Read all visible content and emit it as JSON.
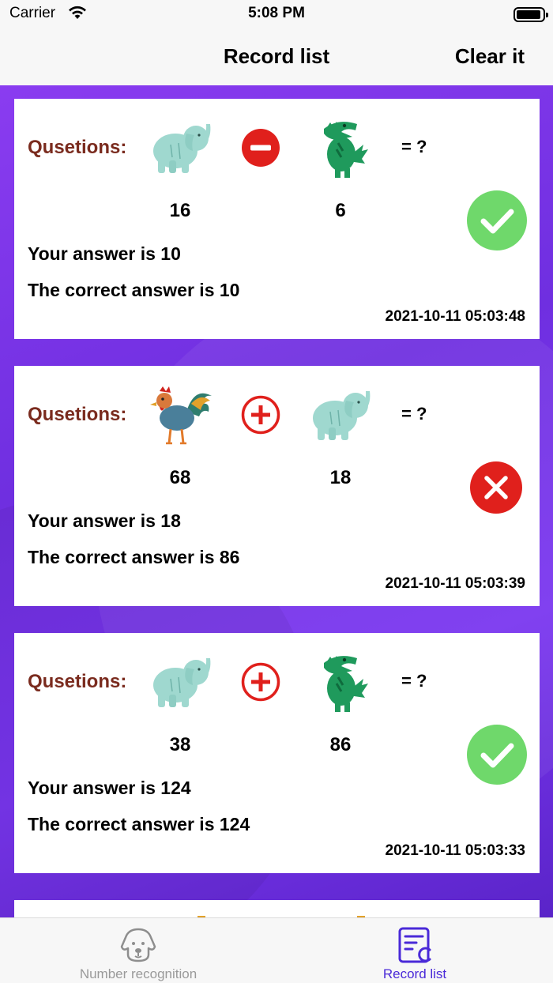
{
  "status_bar": {
    "carrier": "Carrier",
    "time": "5:08 PM"
  },
  "nav": {
    "title": "Record list",
    "clear_label": "Clear it"
  },
  "colors": {
    "accent": "#4a2ad8",
    "correct": "#6fd86b",
    "wrong": "#e0201c",
    "question_label": "#7a2b1e"
  },
  "records": [
    {
      "label": "Qusetions:",
      "left_animal": "elephant-icon",
      "operator": "minus-icon",
      "right_animal": "crocodile-icon",
      "equals": "= ?",
      "left_number": "16",
      "right_number": "6",
      "answer": "Your answer is 10",
      "correct": "The correct answer is 10",
      "time": "2021-10-11 05:03:48",
      "result": "correct"
    },
    {
      "label": "Qusetions:",
      "left_animal": "rooster-icon",
      "operator": "plus-icon",
      "right_animal": "elephant-icon",
      "equals": "= ?",
      "left_number": "68",
      "right_number": "18",
      "answer": "Your answer is 18",
      "correct": "The correct answer is 86",
      "time": "2021-10-11 05:03:39",
      "result": "wrong"
    },
    {
      "label": "Qusetions:",
      "left_animal": "elephant-icon",
      "operator": "plus-icon",
      "right_animal": "crocodile-icon",
      "equals": "= ?",
      "left_number": "38",
      "right_number": "86",
      "answer": "Your answer is 124",
      "correct": "The correct answer is 124",
      "time": "2021-10-11 05:03:33",
      "result": "correct"
    }
  ],
  "tabs": [
    {
      "label": "Number recognition",
      "icon": "dog-icon",
      "selected": false
    },
    {
      "label": "Record list",
      "icon": "record-list-icon",
      "selected": true
    }
  ]
}
